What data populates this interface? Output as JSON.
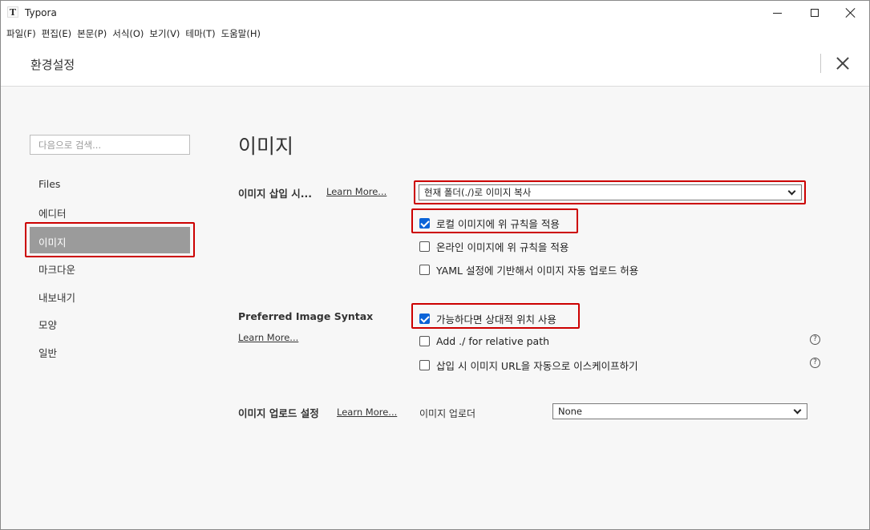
{
  "window": {
    "app_title": "Typora",
    "app_icon_glyph": "T",
    "icons": [
      "typora-app-icon",
      "minimize-icon",
      "maximize-icon",
      "close-icon"
    ]
  },
  "menubar": {
    "items": [
      "파일(F)",
      "편집(E)",
      "본문(P)",
      "서식(O)",
      "보기(V)",
      "테마(T)",
      "도움말(H)"
    ]
  },
  "preferences": {
    "title": "환경설정",
    "close_icon": "close-icon"
  },
  "sidebar": {
    "search_placeholder": "다음으로 검색...",
    "items": [
      {
        "label": "Files",
        "active": false
      },
      {
        "label": "에디터",
        "active": false
      },
      {
        "label": "이미지",
        "active": true
      },
      {
        "label": "마크다운",
        "active": false
      },
      {
        "label": "내보내기",
        "active": false
      },
      {
        "label": "모양",
        "active": false
      },
      {
        "label": "일반",
        "active": false
      }
    ]
  },
  "content": {
    "section_title": "이미지",
    "insert": {
      "label": "이미지 삽입 시...",
      "learn_more": "Learn More...",
      "select_value": "현재 폴더(./)로 이미지 복사",
      "options": [
        {
          "label": "로컬 이미지에 위 규칙을 적용",
          "checked": true
        },
        {
          "label": "온라인 이미지에 위 규칙을 적용",
          "checked": false
        },
        {
          "label": "YAML 설정에 기반해서 이미지 자동 업로드 허용",
          "checked": false
        }
      ]
    },
    "syntax": {
      "label": "Preferred Image Syntax",
      "learn_more": "Learn More...",
      "options": [
        {
          "label": "가능하다면 상대적 위치 사용",
          "checked": true,
          "help": false
        },
        {
          "label": "Add ./ for relative path",
          "checked": false,
          "help": true
        },
        {
          "label": "삽입 시 이미지 URL을 자동으로 이스케이프하기",
          "checked": false,
          "help": true
        }
      ],
      "help_glyph": "?"
    },
    "upload": {
      "label": "이미지 업로드 설정",
      "learn_more": "Learn More...",
      "uploader_label": "이미지 업로더",
      "uploader_value": "None"
    }
  },
  "colors": {
    "highlight": "#cc0000",
    "checkbox_checked": "#0a64d8",
    "sidebar_active": "#9b9b9b",
    "background": "#f7f7f7"
  }
}
